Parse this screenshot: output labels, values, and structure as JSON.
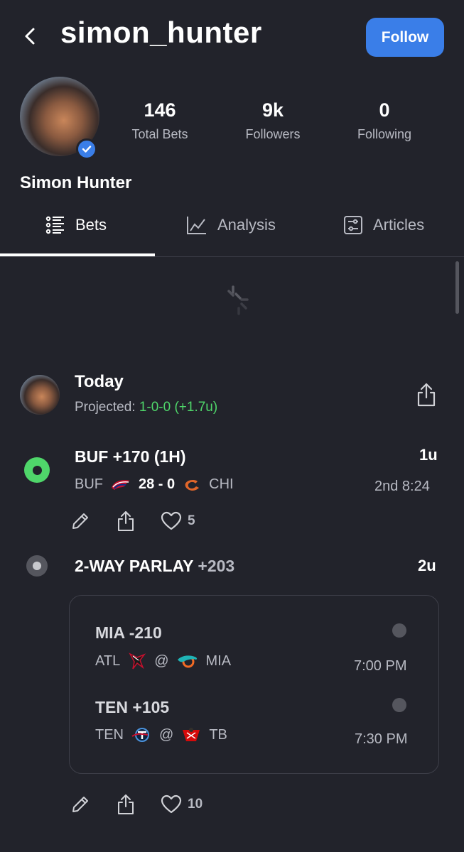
{
  "header": {
    "username": "simon_hunter",
    "follow_label": "Follow"
  },
  "profile": {
    "full_name": "Simon Hunter",
    "stats": [
      {
        "value": "146",
        "label": "Total Bets"
      },
      {
        "value": "9k",
        "label": "Followers"
      },
      {
        "value": "0",
        "label": "Following"
      }
    ]
  },
  "tabs": [
    {
      "label": "Bets",
      "icon": "list-icon",
      "active": true
    },
    {
      "label": "Analysis",
      "icon": "chart-line-icon",
      "active": false
    },
    {
      "label": "Articles",
      "icon": "articles-icon",
      "active": false
    }
  ],
  "feed": {
    "day_title": "Today",
    "projected_label": "Projected:",
    "projected_value": "1-0-0 (+1.7u)"
  },
  "bets": [
    {
      "title": "BUF +170 (1H)",
      "units": "1u",
      "status": "live",
      "team_a": "BUF",
      "score": "28 - 0",
      "team_b": "CHI",
      "time": "2nd 8:24",
      "likes": "5"
    },
    {
      "title_bold": "2-WAY PARLAY",
      "title_odds": "+203",
      "units": "2u",
      "status": "pending",
      "likes": "10",
      "legs": [
        {
          "title": "MIA -210",
          "away": "ATL",
          "at": "@",
          "home": "MIA",
          "time": "7:00 PM"
        },
        {
          "title": "TEN +105",
          "away": "TEN",
          "at": "@",
          "home": "TB",
          "time": "7:30 PM"
        }
      ]
    }
  ],
  "colors": {
    "background": "#22232b",
    "accent": "#3a7ee8",
    "positive": "#4fd66a"
  }
}
